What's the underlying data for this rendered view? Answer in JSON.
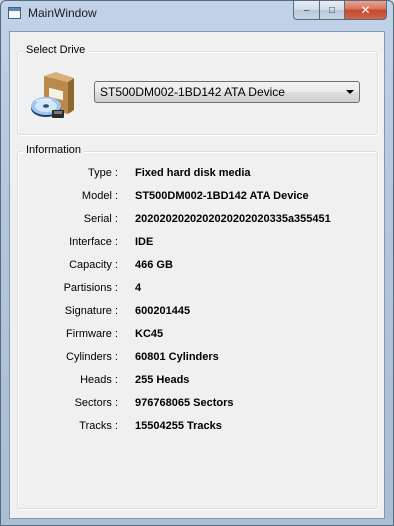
{
  "window": {
    "title": "MainWindow",
    "buttons": {
      "minimize": "–",
      "maximize": "□",
      "close": "✕"
    }
  },
  "select_drive": {
    "group_title": "Select Drive",
    "icon": "disk-drive-box-icon",
    "selected_drive": "ST500DM002-1BD142 ATA Device"
  },
  "information": {
    "group_title": "Information",
    "rows": [
      {
        "label": "Type :",
        "value": "Fixed hard disk media"
      },
      {
        "label": "Model :",
        "value": "ST500DM002-1BD142 ATA Device"
      },
      {
        "label": "Serial :",
        "value": "2020202020202020202020335a355451"
      },
      {
        "label": "Interface :",
        "value": "IDE"
      },
      {
        "label": "Capacity :",
        "value": "466 GB"
      },
      {
        "label": "Partisions :",
        "value": "4"
      },
      {
        "label": "Signature :",
        "value": "600201445"
      },
      {
        "label": "Firmware :",
        "value": "KC45"
      },
      {
        "label": "Cylinders :",
        "value": "60801 Cylinders"
      },
      {
        "label": "Heads :",
        "value": "255 Heads"
      },
      {
        "label": "Sectors :",
        "value": "976768065 Sectors"
      },
      {
        "label": "Tracks :",
        "value": "15504255 Tracks"
      }
    ]
  }
}
